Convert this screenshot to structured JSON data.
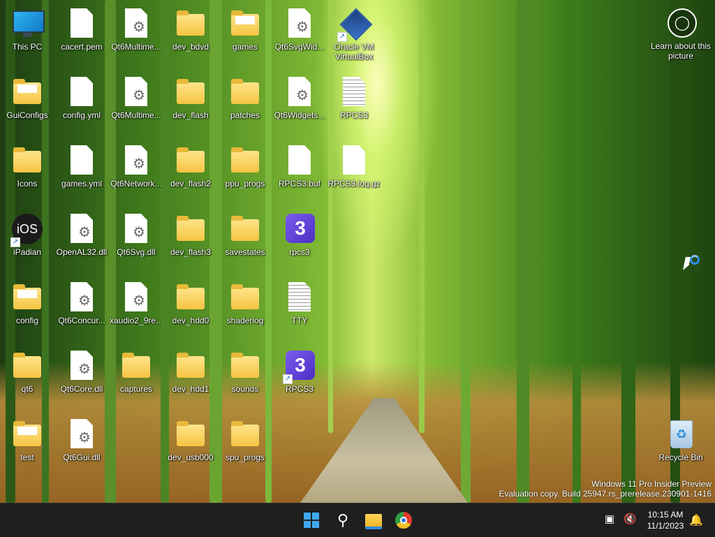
{
  "desktop": {
    "icons": [
      {
        "label": "This PC",
        "type": "pc"
      },
      {
        "label": "GuiConfigs",
        "type": "folder-paper"
      },
      {
        "label": "Icons",
        "type": "folder"
      },
      {
        "label": "iPadian",
        "type": "ios",
        "shortcut": true
      },
      {
        "label": "config",
        "type": "folder-paper"
      },
      {
        "label": "qt6",
        "type": "folder"
      },
      {
        "label": "test",
        "type": "folder-paper"
      },
      {
        "label": "cacert.pem",
        "type": "file"
      },
      {
        "label": "config.yml",
        "type": "file"
      },
      {
        "label": "games.yml",
        "type": "file"
      },
      {
        "label": "OpenAL32.dll",
        "type": "dll"
      },
      {
        "label": "Qt6Concur...",
        "type": "dll"
      },
      {
        "label": "Qt6Core.dll",
        "type": "dll"
      },
      {
        "label": "Qt6Gui.dll",
        "type": "dll"
      },
      {
        "label": "Qt6Multime...",
        "type": "dll"
      },
      {
        "label": "Qt6Multime...",
        "type": "dll"
      },
      {
        "label": "Qt6Network...",
        "type": "dll"
      },
      {
        "label": "Qt6Svg.dll",
        "type": "dll"
      },
      {
        "label": "xaudio2_9re...",
        "type": "dll"
      },
      {
        "label": "captures",
        "type": "folder"
      },
      {
        "label": "dev_bdvd",
        "type": "folder"
      },
      {
        "label": "dev_flash",
        "type": "folder"
      },
      {
        "label": "dev_flash2",
        "type": "folder"
      },
      {
        "label": "dev_flash3",
        "type": "folder"
      },
      {
        "label": "dev_hdd0",
        "type": "folder"
      },
      {
        "label": "dev_hdd1",
        "type": "folder"
      },
      {
        "label": "dev_usb000",
        "type": "folder"
      },
      {
        "label": "games",
        "type": "folder-paper"
      },
      {
        "label": "patches",
        "type": "folder"
      },
      {
        "label": "ppu_progs",
        "type": "folder"
      },
      {
        "label": "savestates",
        "type": "folder"
      },
      {
        "label": "shaderlog",
        "type": "folder"
      },
      {
        "label": "sounds",
        "type": "folder"
      },
      {
        "label": "spu_progs",
        "type": "folder"
      },
      {
        "label": "Qt6SvgWid...",
        "type": "dll"
      },
      {
        "label": "Qt6Widgets...",
        "type": "dll"
      },
      {
        "label": "RPCS3.buf",
        "type": "file"
      },
      {
        "label": "rpcs3",
        "type": "rpcs3"
      },
      {
        "label": "TTY",
        "type": "text"
      },
      {
        "label": "RPCS3",
        "type": "rpcs3",
        "shortcut": true
      },
      {
        "label": "Oracle VM VirtualBox",
        "type": "vbox",
        "shortcut": true
      },
      {
        "label": "RPCS3",
        "type": "text"
      },
      {
        "label": "RPCS3.log.gz",
        "type": "file"
      },
      {
        "label": "Recycle Bin",
        "type": "bin"
      }
    ],
    "learn_label": "Learn about this picture",
    "watermark_line1": "Windows 11 Pro Insider Preview",
    "watermark_line2": "Evaluation copy. Build 25947.rs_prerelease.230901-1416"
  },
  "taskbar": {
    "items": [
      {
        "name": "start-button",
        "icon": "windows-logo"
      },
      {
        "name": "search-button",
        "icon": "search-icon"
      },
      {
        "name": "file-explorer-button",
        "icon": "folder-icon"
      },
      {
        "name": "chrome-button",
        "icon": "chrome-icon"
      }
    ],
    "time": "10:15 AM",
    "date": "11/1/2023"
  },
  "colors": {
    "taskbar_bg": "#1f1f1f",
    "accent": "#3ea8f2",
    "folder": "#f5c542",
    "rpcs3": "#5b3fd6"
  }
}
